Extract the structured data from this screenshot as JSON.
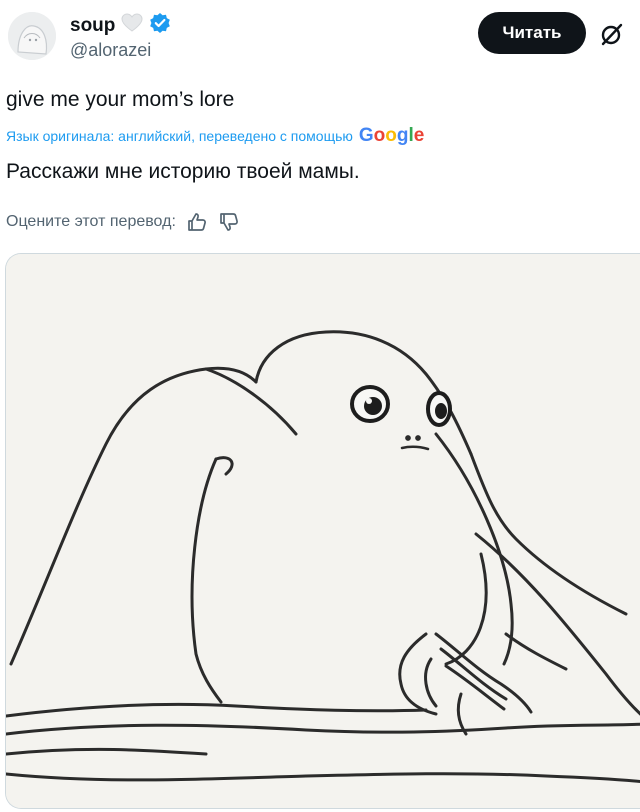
{
  "user": {
    "name": "soup",
    "handle": "@alorazei"
  },
  "actions": {
    "follow_label": "Читать"
  },
  "tweet": {
    "text": "give me your mom’s lore",
    "translation_meta": "Язык оригинала: английский, переведено с помощью",
    "translation_provider": [
      "G",
      "o",
      "o",
      "g",
      "l",
      "e"
    ],
    "translated_text": "Расскажи мне историю твоей мамы.",
    "rate_prompt": "Оцените этот перевод:"
  },
  "colors": {
    "accent": "#1d9bf0",
    "verified": "#1d9bf0",
    "button": "#0f1419",
    "secondary_text": "#536471"
  },
  "icons": {
    "verified": "verified-badge-icon",
    "heart": "heart-icon",
    "grok": "grok-icon",
    "thumbs_up": "thumbs-up-icon",
    "thumbs_down": "thumbs-down-icon"
  }
}
